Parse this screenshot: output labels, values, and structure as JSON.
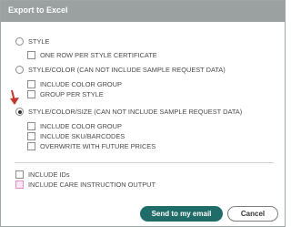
{
  "dialog": {
    "title": "Export to Excel"
  },
  "options": {
    "style": {
      "label": "STYLE",
      "checked": false
    },
    "one_row": {
      "label": "ONE ROW PER STYLE CERTIFICATE",
      "checked": false
    },
    "style_color": {
      "label": "STYLE/COLOR (CAN NOT INCLUDE SAMPLE REQUEST DATA)",
      "checked": false
    },
    "sc_color_group": {
      "label": "INCLUDE COLOR GROUP",
      "checked": false
    },
    "sc_group_per_style": {
      "label": "GROUP PER STYLE",
      "checked": false
    },
    "style_color_size": {
      "label": "STYLE/COLOR/SIZE (CAN NOT INCLUDE SAMPLE REQUEST DATA)",
      "checked": true
    },
    "scs_color_group": {
      "label": "INCLUDE COLOR GROUP",
      "checked": false
    },
    "scs_sku": {
      "label": "INCLUDE SKU/BARCODES",
      "checked": false
    },
    "scs_overwrite": {
      "label": "OVERWRITE WITH FUTURE PRICES",
      "checked": false
    },
    "include_ids": {
      "label": "INCLUDE IDs",
      "checked": false
    },
    "care_instruction": {
      "label": "INCLUDE CARE INSTRUCTION OUTPUT",
      "checked": false
    }
  },
  "buttons": {
    "send": "Send to my email",
    "cancel": "Cancel"
  },
  "colors": {
    "titlebar": "#9aa1a0",
    "primary": "#1f6c68",
    "arrow": "#c0392b"
  },
  "icons": {
    "pointer": "red-arrow-icon"
  }
}
